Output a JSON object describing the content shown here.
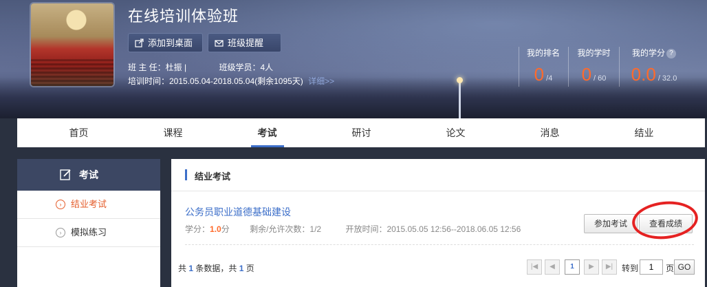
{
  "class": {
    "title": "在线培训体验班",
    "add_desktop_label": "添加到桌面",
    "remind_label": "班级提醒",
    "head_teacher": "班 主 任：杜振 |",
    "members": "班级学员：4人",
    "training_time": "培训时间：2015.05.04-2018.05.04(剩余1095天)",
    "details_link": "详细>>"
  },
  "stats": {
    "rank": {
      "label": "我的排名",
      "value": "0",
      "total": "/4"
    },
    "hours": {
      "label": "我的学时",
      "value": "0",
      "total": "/ 60"
    },
    "credits": {
      "label": "我的学分",
      "help": "?",
      "value": "0.0",
      "total": "/ 32.0"
    }
  },
  "nav": {
    "tabs": [
      "首页",
      "课程",
      "考试",
      "研讨",
      "论文",
      "消息",
      "结业"
    ],
    "active": "考试"
  },
  "sidebar": {
    "title": "考试",
    "items": [
      {
        "label": "结业考试",
        "icon": "chevron-right-circle-icon",
        "active": true
      },
      {
        "label": "模拟练习",
        "icon": "chevron-right-circle-icon",
        "active": false
      }
    ]
  },
  "main": {
    "section_title": "结业考试",
    "exam": {
      "name": "公务员职业道德基础建设",
      "credit_label": "学分：",
      "credit_value": "1.0",
      "credit_unit": "分",
      "attempts": "剩余/允许次数：1/2",
      "open_time": "开放时间：2015.05.05 12:56--2018.06.05 12:56",
      "join_label": "参加考试",
      "score_label": "查看成绩"
    },
    "pagination": {
      "prefix": "共 ",
      "count": "1",
      "middle": " 条数据，共 ",
      "pages": "1",
      "suffix": " 页",
      "current_page": "1",
      "goto_label": "转到",
      "page_unit": "页",
      "input_value": "1",
      "go_label": "GO"
    }
  },
  "colors": {
    "accent": "#3d6fc9",
    "highlight": "#ff6a2b",
    "annotation": "#e52222"
  }
}
